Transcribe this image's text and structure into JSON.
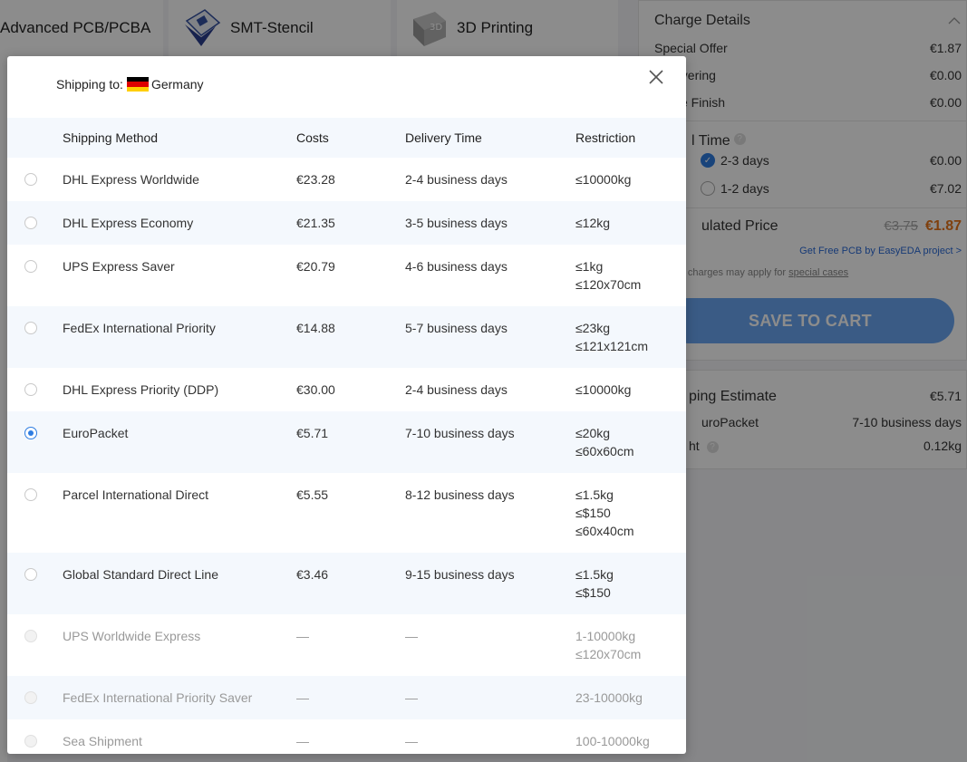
{
  "background": {
    "tabs": [
      {
        "label": "Advanced PCB/PCBA"
      },
      {
        "label": "SMT-Stencil"
      },
      {
        "label": "3D Printing"
      }
    ],
    "charge_details": {
      "title": "Charge Details",
      "rows": [
        {
          "label": "Special Offer",
          "value": "€1.87"
        },
        {
          "label": "overing",
          "value": "€0.00"
        },
        {
          "label": "ce Finish",
          "value": "€0.00"
        }
      ],
      "build_time": {
        "label": "l Time",
        "options": [
          {
            "label": "2-3 days",
            "value": "€0.00",
            "selected": true
          },
          {
            "label": "1-2 days",
            "value": "€7.02",
            "selected": false
          }
        ]
      },
      "calculated_price": {
        "label": "ulated Price",
        "old": "€3.75",
        "new": "€1.87"
      },
      "free_link": "Get Free PCB by EasyEDA project >",
      "note_prefix": "onal charges may apply for ",
      "note_link": "special cases",
      "save_button": "SAVE TO CART"
    },
    "shipping_estimate": {
      "title": "ping Estimate",
      "cost": "€5.71",
      "method": "uroPacket",
      "time": "7-10 business days",
      "weight_label": "ht",
      "weight": "0.12kg"
    }
  },
  "modal": {
    "shipping_to_label": "Shipping to:",
    "country": "Germany",
    "flag_colors": [
      "#000000",
      "#dd0000",
      "#ffce00"
    ],
    "columns": {
      "method": "Shipping Method",
      "cost": "Costs",
      "time": "Delivery Time",
      "restriction": "Restriction"
    },
    "rows": [
      {
        "method": "DHL Express Worldwide",
        "cost": "€23.28",
        "time": "2-4 business days",
        "restriction": [
          "≤10000kg"
        ],
        "selected": false,
        "disabled": false
      },
      {
        "method": "DHL Express Economy",
        "cost": "€21.35",
        "time": "3-5 business days",
        "restriction": [
          "≤12kg"
        ],
        "selected": false,
        "disabled": false
      },
      {
        "method": "UPS Express Saver",
        "cost": "€20.79",
        "time": "4-6 business days",
        "restriction": [
          "≤1kg",
          "≤120x70cm"
        ],
        "selected": false,
        "disabled": false
      },
      {
        "method": "FedEx International Priority",
        "cost": "€14.88",
        "time": "5-7 business days",
        "restriction": [
          "≤23kg",
          "≤121x121cm"
        ],
        "selected": false,
        "disabled": false
      },
      {
        "method": "DHL Express Priority (DDP)",
        "cost": "€30.00",
        "time": "2-4 business days",
        "restriction": [
          "≤10000kg"
        ],
        "selected": false,
        "disabled": false
      },
      {
        "method": "EuroPacket",
        "cost": "€5.71",
        "time": "7-10 business days",
        "restriction": [
          "≤20kg",
          "≤60x60cm"
        ],
        "selected": true,
        "disabled": false
      },
      {
        "method": "Parcel International Direct",
        "cost": "€5.55",
        "time": "8-12 business days",
        "restriction": [
          "≤1.5kg",
          "≤$150",
          "≤60x40cm"
        ],
        "selected": false,
        "disabled": false
      },
      {
        "method": "Global Standard Direct Line",
        "cost": "€3.46",
        "time": "9-15 business days",
        "restriction": [
          "≤1.5kg",
          "≤$150"
        ],
        "selected": false,
        "disabled": false
      },
      {
        "method": "UPS Worldwide Express",
        "cost": "—",
        "time": "—",
        "restriction": [
          "1-10000kg",
          "≤120x70cm"
        ],
        "selected": false,
        "disabled": true
      },
      {
        "method": "FedEx International Priority Saver",
        "cost": "—",
        "time": "—",
        "restriction": [
          "23-10000kg"
        ],
        "selected": false,
        "disabled": true
      },
      {
        "method": "Sea Shipment",
        "cost": "—",
        "time": "—",
        "restriction": [
          "100-10000kg"
        ],
        "selected": false,
        "disabled": true
      }
    ]
  }
}
